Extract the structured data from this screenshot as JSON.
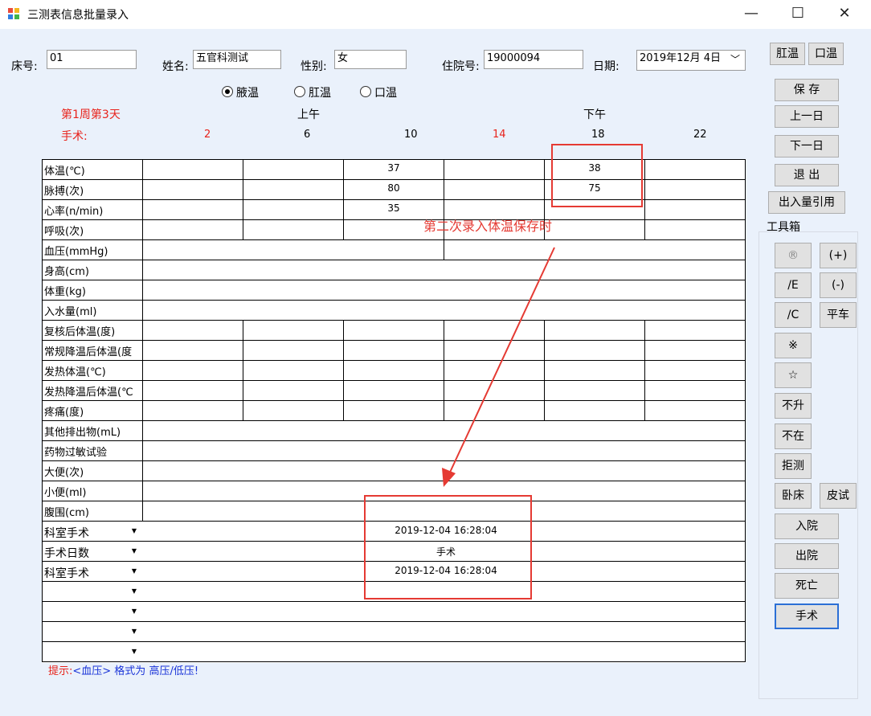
{
  "window": {
    "title": "三测表信息批量录入",
    "minimize": "—",
    "maximize": "☐",
    "close": "✕"
  },
  "form": {
    "bed_label": "床号:",
    "bed_value": "01",
    "name_label": "姓名:",
    "name_value": "五官科测试",
    "gender_label": "性别:",
    "gender_value": "女",
    "admission_label": "住院号:",
    "admission_value": "19000094",
    "date_label": "日期:",
    "date_value": "2019年12月 4日"
  },
  "temp_mode": {
    "axillary": "腋温",
    "rectal": "肛温",
    "oral": "口温",
    "selected": "axillary"
  },
  "schedule": {
    "week_day": "第1周第3天",
    "surgery_label": "手术:",
    "am": "上午",
    "pm": "下午",
    "hours": [
      "2",
      "6",
      "10",
      "14",
      "18",
      "22"
    ]
  },
  "rows": [
    "体温(℃)",
    "脉搏(次)",
    "心率(n/min)",
    "呼吸(次)",
    "血压(mmHg)",
    "身高(cm)",
    "体重(kg)",
    "入水量(ml)",
    "复核后体温(度)",
    "常规降温后体温(度",
    "发热体温(℃)",
    "发热降温后体温(℃",
    "疼痛(度)",
    "其他排出物(mL)",
    "药物过敏试验",
    "大便(次)",
    "小便(ml)",
    "腹围(cm)"
  ],
  "values": {
    "temp_10": "37",
    "temp_18": "38",
    "pulse_10": "80",
    "pulse_18": "75",
    "heart_10": "35"
  },
  "event_rows": [
    {
      "type": "科室手术",
      "value": "2019-12-04 16:28:04"
    },
    {
      "type": "手术日数",
      "value": "手术"
    },
    {
      "type": "科室手术",
      "value": "2019-12-04 16:28:04"
    },
    {
      "type": "",
      "value": ""
    },
    {
      "type": "",
      "value": ""
    },
    {
      "type": "",
      "value": ""
    },
    {
      "type": "",
      "value": ""
    }
  ],
  "annotation": {
    "text": "第二次录入体温保存时",
    "color": "#e53a33"
  },
  "hint": {
    "prefix": "提示:",
    "text": "<血压> 格式为 高压/低压!"
  },
  "right_panel": {
    "top_buttons": [
      "肛温",
      "口温"
    ],
    "actions": [
      "保 存",
      "上一日",
      "下一日",
      "退 出",
      "出入量引用"
    ],
    "toolbox_label": "工具箱",
    "tools": [
      "®",
      "(+)",
      "/E",
      "(-)",
      "/C",
      "平车",
      "※",
      "☆",
      "不升",
      "不在",
      "拒测",
      "卧床",
      "皮试",
      "入院",
      "出院",
      "死亡",
      "手术"
    ]
  }
}
